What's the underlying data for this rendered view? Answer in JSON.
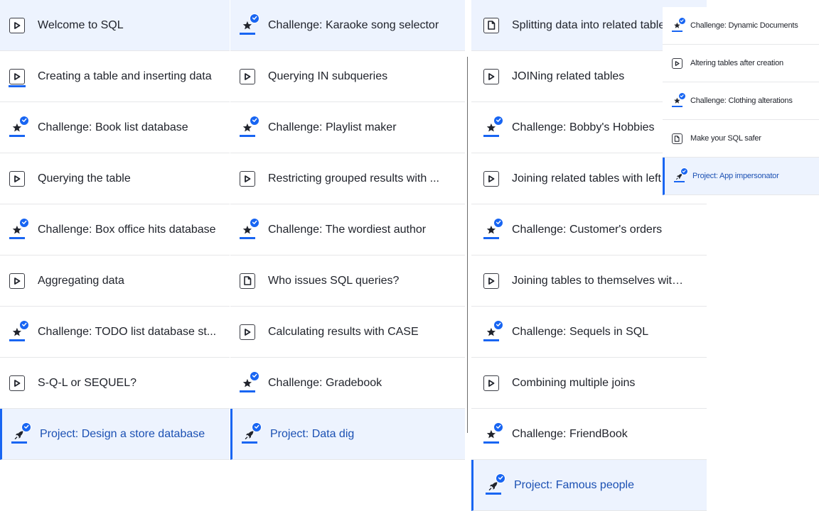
{
  "columns": [
    {
      "items": [
        {
          "title": "Welcome to SQL",
          "kind": "video",
          "active": true,
          "current": false,
          "progress": false
        },
        {
          "title": "Creating a table and inserting data",
          "kind": "video",
          "active": false,
          "current": false,
          "progress": true
        },
        {
          "title": "Challenge: Book list database",
          "kind": "challenge",
          "active": false,
          "current": false
        },
        {
          "title": "Querying the table",
          "kind": "video",
          "active": false,
          "current": false
        },
        {
          "title": "Challenge: Box office hits database",
          "kind": "challenge",
          "active": false,
          "current": false
        },
        {
          "title": "Aggregating data",
          "kind": "video",
          "active": false,
          "current": false
        },
        {
          "title": "Challenge: TODO list database st...",
          "kind": "challenge",
          "active": false,
          "current": false
        },
        {
          "title": "S-Q-L or SEQUEL?",
          "kind": "video",
          "active": false,
          "current": false
        },
        {
          "title": "Project: Design a store database",
          "kind": "project",
          "active": true,
          "current": true
        }
      ]
    },
    {
      "items": [
        {
          "title": "Challenge: Karaoke song selector",
          "kind": "challenge",
          "active": true,
          "current": false
        },
        {
          "title": "Querying IN subqueries",
          "kind": "video",
          "active": false,
          "current": false
        },
        {
          "title": "Challenge: Playlist maker",
          "kind": "challenge",
          "active": false,
          "current": false
        },
        {
          "title": "Restricting grouped results with ...",
          "kind": "video",
          "active": false,
          "current": false
        },
        {
          "title": "Challenge: The wordiest author",
          "kind": "challenge",
          "active": false,
          "current": false
        },
        {
          "title": "Who issues SQL queries?",
          "kind": "article",
          "active": false,
          "current": false
        },
        {
          "title": "Calculating results with CASE",
          "kind": "video",
          "active": false,
          "current": false
        },
        {
          "title": "Challenge: Gradebook",
          "kind": "challenge",
          "active": false,
          "current": false
        },
        {
          "title": "Project: Data dig",
          "kind": "project",
          "active": true,
          "current": true
        }
      ]
    },
    {
      "items": [
        {
          "title": "Splitting data into related tables",
          "kind": "article",
          "active": true,
          "current": false
        },
        {
          "title": "JOINing related tables",
          "kind": "video",
          "active": false,
          "current": false
        },
        {
          "title": "Challenge: Bobby's Hobbies",
          "kind": "challenge",
          "active": false,
          "current": false
        },
        {
          "title": "Joining related tables with left",
          "kind": "video",
          "active": false,
          "current": false
        },
        {
          "title": "Challenge: Customer's orders",
          "kind": "challenge",
          "active": false,
          "current": false
        },
        {
          "title": "Joining tables to themselves with...",
          "kind": "video",
          "active": false,
          "current": false
        },
        {
          "title": "Challenge: Sequels in SQL",
          "kind": "challenge",
          "active": false,
          "current": false
        },
        {
          "title": "Combining multiple joins",
          "kind": "video",
          "active": false,
          "current": false
        },
        {
          "title": "Challenge: FriendBook",
          "kind": "challenge",
          "active": false,
          "current": false
        },
        {
          "title": "Project: Famous people",
          "kind": "project",
          "active": true,
          "current": true
        }
      ]
    },
    {
      "items": [
        {
          "title": "Challenge: Dynamic Documents",
          "kind": "challenge",
          "active": false,
          "current": false
        },
        {
          "title": "Altering tables after creation",
          "kind": "video",
          "active": false,
          "current": false
        },
        {
          "title": "Challenge: Clothing alterations",
          "kind": "challenge",
          "active": false,
          "current": false
        },
        {
          "title": "Make your SQL safer",
          "kind": "article",
          "active": false,
          "current": false
        },
        {
          "title": "Project: App impersonator",
          "kind": "project",
          "active": true,
          "current": true
        }
      ]
    }
  ],
  "icons": {
    "video": "play-icon",
    "article": "article-icon",
    "challenge": "star-icon",
    "project": "rocket-icon",
    "completed": "checkmark-icon"
  },
  "colors": {
    "accent": "#1865f2",
    "active_background": "#edf3fe",
    "current_text": "#1b50b3"
  }
}
